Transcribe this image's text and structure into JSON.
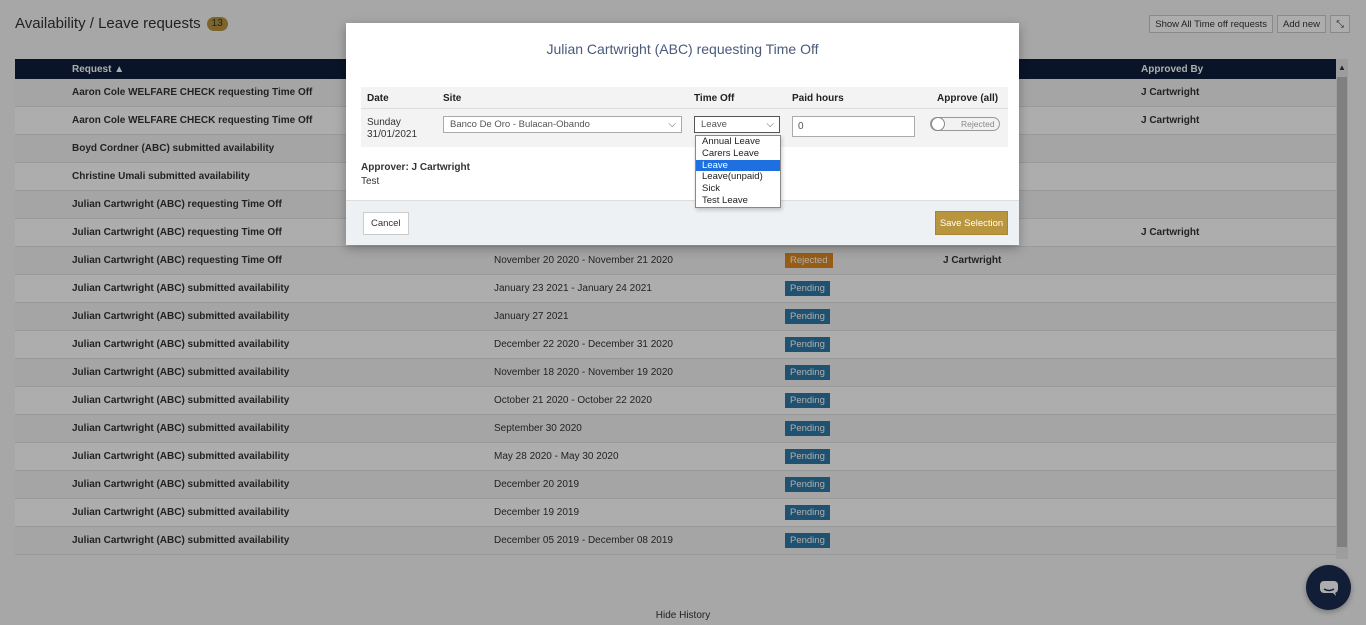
{
  "page": {
    "title": "Availability / Leave requests",
    "count": "13",
    "actions": {
      "show_all": "Show All Time off requests",
      "add_new": "Add new",
      "collapse_icon": "⤡"
    }
  },
  "table": {
    "headers": {
      "request": "Request ▲",
      "approved_by": "Approved By"
    },
    "rows": [
      {
        "request": "Aaron Cole WELFARE CHECK requesting Time Off",
        "date": "",
        "status": "",
        "status_type": "",
        "by": "",
        "by2": "J Cartwright"
      },
      {
        "request": "Aaron Cole WELFARE CHECK requesting Time Off",
        "date": "",
        "status": "",
        "status_type": "",
        "by": "",
        "by2": "J Cartwright"
      },
      {
        "request": "Boyd Cordner (ABC) submitted availability",
        "date": "",
        "status": "",
        "status_type": "",
        "by": "",
        "by2": ""
      },
      {
        "request": "Christine Umali submitted availability",
        "date": "",
        "status": "",
        "status_type": "",
        "by": "",
        "by2": ""
      },
      {
        "request": "Julian Cartwright (ABC) requesting Time Off",
        "date": "",
        "status": "",
        "status_type": "",
        "by": "",
        "by2": ""
      },
      {
        "request": "Julian Cartwright (ABC) requesting Time Off",
        "date": "",
        "status": "",
        "status_type": "",
        "by": "",
        "by2": "J Cartwright"
      },
      {
        "request": "Julian Cartwright (ABC) requesting Time Off",
        "date": "November 20 2020 - November 21 2020",
        "status": "Rejected",
        "status_type": "rejected",
        "by": "J Cartwright",
        "by2": ""
      },
      {
        "request": "Julian Cartwright (ABC) submitted availability",
        "date": "January 23 2021 - January 24 2021",
        "status": "Pending",
        "status_type": "pending",
        "by": "",
        "by2": ""
      },
      {
        "request": "Julian Cartwright (ABC) submitted availability",
        "date": "January 27 2021",
        "status": "Pending",
        "status_type": "pending",
        "by": "",
        "by2": ""
      },
      {
        "request": "Julian Cartwright (ABC) submitted availability",
        "date": "December 22 2020 - December 31 2020",
        "status": "Pending",
        "status_type": "pending",
        "by": "",
        "by2": ""
      },
      {
        "request": "Julian Cartwright (ABC) submitted availability",
        "date": "November 18 2020 - November 19 2020",
        "status": "Pending",
        "status_type": "pending",
        "by": "",
        "by2": ""
      },
      {
        "request": "Julian Cartwright (ABC) submitted availability",
        "date": "October 21 2020 - October 22 2020",
        "status": "Pending",
        "status_type": "pending",
        "by": "",
        "by2": ""
      },
      {
        "request": "Julian Cartwright (ABC) submitted availability",
        "date": "September 30 2020",
        "status": "Pending",
        "status_type": "pending",
        "by": "",
        "by2": ""
      },
      {
        "request": "Julian Cartwright (ABC) submitted availability",
        "date": "May 28 2020 - May 30 2020",
        "status": "Pending",
        "status_type": "pending",
        "by": "",
        "by2": ""
      },
      {
        "request": "Julian Cartwright (ABC) submitted availability",
        "date": "December 20 2019",
        "status": "Pending",
        "status_type": "pending",
        "by": "",
        "by2": ""
      },
      {
        "request": "Julian Cartwright (ABC) submitted availability",
        "date": "December 19 2019",
        "status": "Pending",
        "status_type": "pending",
        "by": "",
        "by2": ""
      },
      {
        "request": "Julian Cartwright (ABC) submitted availability",
        "date": "December 05 2019 - December 08 2019",
        "status": "Pending",
        "status_type": "pending",
        "by": "",
        "by2": ""
      }
    ]
  },
  "footer": {
    "hide_history": "Hide History"
  },
  "modal": {
    "title": "Julian Cartwright (ABC) requesting Time Off",
    "headers": {
      "date": "Date",
      "site": "Site",
      "time_off": "Time Off",
      "paid_hours": "Paid hours",
      "approve": "Approve (all)"
    },
    "row": {
      "day": "Sunday",
      "date": "31/01/2021",
      "site": "Banco De Oro - Bulacan-Obando",
      "time_off": "Leave",
      "paid_hours": "0",
      "approve_state": "Rejected"
    },
    "time_off_options": [
      "Annual Leave",
      "Carers Leave",
      "Leave",
      "Leave(unpaid)",
      "Sick",
      "Test Leave"
    ],
    "selected_option_index": 2,
    "approver": "Approver: J Cartwright",
    "note": "Test",
    "cancel": "Cancel",
    "save": "Save Selection"
  },
  "colors": {
    "header_navy": "#0e1e3c",
    "accent_gold": "#b9963e",
    "pending_blue": "#2e7aa5",
    "rejected_orange": "#e08a1e",
    "select_blue": "#1e6fe0"
  },
  "icons": {
    "chat": "chat-bubble-icon",
    "chevron": "chevron-down-icon"
  }
}
